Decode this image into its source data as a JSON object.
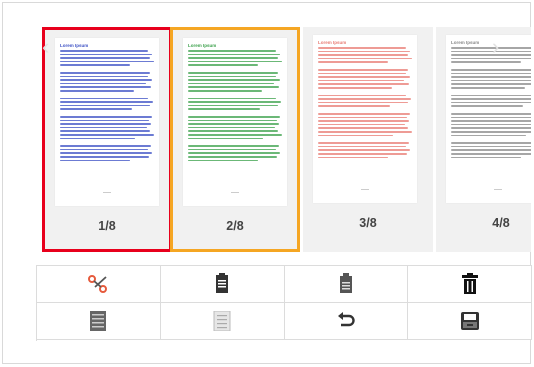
{
  "thumbnails": [
    {
      "label": "1/8",
      "title": "Lorem Ipsum",
      "text_color": "#3b4fc4",
      "selection": "red"
    },
    {
      "label": "2/8",
      "title": "Lorem Ipsum",
      "text_color": "#3aa04a",
      "selection": "orange"
    },
    {
      "label": "3/8",
      "title": "Lorem Ipsum",
      "text_color": "#e87a72",
      "selection": "none"
    },
    {
      "label": "4/8",
      "title": "Lorem Ipsum",
      "text_color": "#888888",
      "selection": "none"
    }
  ],
  "navigation": {
    "prev_icon": "chevron-left-icon",
    "next_icon": "chevron-right-icon"
  },
  "toolbar": {
    "buttons": [
      {
        "name": "cut",
        "icon": "scissors-icon"
      },
      {
        "name": "copy",
        "icon": "copy-icon"
      },
      {
        "name": "paste",
        "icon": "paste-icon"
      },
      {
        "name": "delete",
        "icon": "trash-icon"
      },
      {
        "name": "select-all",
        "icon": "select-all-icon"
      },
      {
        "name": "deselect",
        "icon": "deselect-icon"
      },
      {
        "name": "undo",
        "icon": "undo-icon"
      },
      {
        "name": "save",
        "icon": "inbox-save-icon"
      }
    ]
  },
  "colors": {
    "selected_primary": "#e8001c",
    "selected_secondary": "#f5a623",
    "icon_dark": "#333333",
    "icon_light": "#aaaaaa",
    "scissors": "#e65a3c"
  }
}
